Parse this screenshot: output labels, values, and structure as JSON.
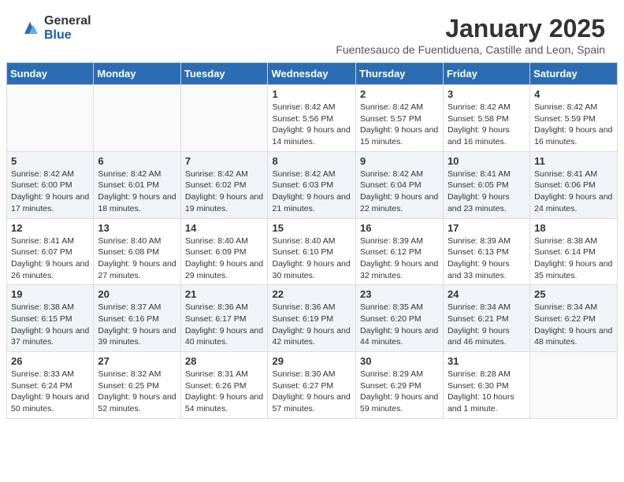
{
  "logo": {
    "general": "General",
    "blue": "Blue"
  },
  "header": {
    "month": "January 2025",
    "location": "Fuentesauco de Fuentiduena, Castille and Leon, Spain"
  },
  "weekdays": [
    "Sunday",
    "Monday",
    "Tuesday",
    "Wednesday",
    "Thursday",
    "Friday",
    "Saturday"
  ],
  "weeks": [
    [
      {
        "day": "",
        "info": ""
      },
      {
        "day": "",
        "info": ""
      },
      {
        "day": "",
        "info": ""
      },
      {
        "day": "1",
        "info": "Sunrise: 8:42 AM\nSunset: 5:56 PM\nDaylight: 9 hours and 14 minutes."
      },
      {
        "day": "2",
        "info": "Sunrise: 8:42 AM\nSunset: 5:57 PM\nDaylight: 9 hours and 15 minutes."
      },
      {
        "day": "3",
        "info": "Sunrise: 8:42 AM\nSunset: 5:58 PM\nDaylight: 9 hours and 16 minutes."
      },
      {
        "day": "4",
        "info": "Sunrise: 8:42 AM\nSunset: 5:59 PM\nDaylight: 9 hours and 16 minutes."
      }
    ],
    [
      {
        "day": "5",
        "info": "Sunrise: 8:42 AM\nSunset: 6:00 PM\nDaylight: 9 hours and 17 minutes."
      },
      {
        "day": "6",
        "info": "Sunrise: 8:42 AM\nSunset: 6:01 PM\nDaylight: 9 hours and 18 minutes."
      },
      {
        "day": "7",
        "info": "Sunrise: 8:42 AM\nSunset: 6:02 PM\nDaylight: 9 hours and 19 minutes."
      },
      {
        "day": "8",
        "info": "Sunrise: 8:42 AM\nSunset: 6:03 PM\nDaylight: 9 hours and 21 minutes."
      },
      {
        "day": "9",
        "info": "Sunrise: 8:42 AM\nSunset: 6:04 PM\nDaylight: 9 hours and 22 minutes."
      },
      {
        "day": "10",
        "info": "Sunrise: 8:41 AM\nSunset: 6:05 PM\nDaylight: 9 hours and 23 minutes."
      },
      {
        "day": "11",
        "info": "Sunrise: 8:41 AM\nSunset: 6:06 PM\nDaylight: 9 hours and 24 minutes."
      }
    ],
    [
      {
        "day": "12",
        "info": "Sunrise: 8:41 AM\nSunset: 6:07 PM\nDaylight: 9 hours and 26 minutes."
      },
      {
        "day": "13",
        "info": "Sunrise: 8:40 AM\nSunset: 6:08 PM\nDaylight: 9 hours and 27 minutes."
      },
      {
        "day": "14",
        "info": "Sunrise: 8:40 AM\nSunset: 6:09 PM\nDaylight: 9 hours and 29 minutes."
      },
      {
        "day": "15",
        "info": "Sunrise: 8:40 AM\nSunset: 6:10 PM\nDaylight: 9 hours and 30 minutes."
      },
      {
        "day": "16",
        "info": "Sunrise: 8:39 AM\nSunset: 6:12 PM\nDaylight: 9 hours and 32 minutes."
      },
      {
        "day": "17",
        "info": "Sunrise: 8:39 AM\nSunset: 6:13 PM\nDaylight: 9 hours and 33 minutes."
      },
      {
        "day": "18",
        "info": "Sunrise: 8:38 AM\nSunset: 6:14 PM\nDaylight: 9 hours and 35 minutes."
      }
    ],
    [
      {
        "day": "19",
        "info": "Sunrise: 8:38 AM\nSunset: 6:15 PM\nDaylight: 9 hours and 37 minutes."
      },
      {
        "day": "20",
        "info": "Sunrise: 8:37 AM\nSunset: 6:16 PM\nDaylight: 9 hours and 39 minutes."
      },
      {
        "day": "21",
        "info": "Sunrise: 8:36 AM\nSunset: 6:17 PM\nDaylight: 9 hours and 40 minutes."
      },
      {
        "day": "22",
        "info": "Sunrise: 8:36 AM\nSunset: 6:19 PM\nDaylight: 9 hours and 42 minutes."
      },
      {
        "day": "23",
        "info": "Sunrise: 8:35 AM\nSunset: 6:20 PM\nDaylight: 9 hours and 44 minutes."
      },
      {
        "day": "24",
        "info": "Sunrise: 8:34 AM\nSunset: 6:21 PM\nDaylight: 9 hours and 46 minutes."
      },
      {
        "day": "25",
        "info": "Sunrise: 8:34 AM\nSunset: 6:22 PM\nDaylight: 9 hours and 48 minutes."
      }
    ],
    [
      {
        "day": "26",
        "info": "Sunrise: 8:33 AM\nSunset: 6:24 PM\nDaylight: 9 hours and 50 minutes."
      },
      {
        "day": "27",
        "info": "Sunrise: 8:32 AM\nSunset: 6:25 PM\nDaylight: 9 hours and 52 minutes."
      },
      {
        "day": "28",
        "info": "Sunrise: 8:31 AM\nSunset: 6:26 PM\nDaylight: 9 hours and 54 minutes."
      },
      {
        "day": "29",
        "info": "Sunrise: 8:30 AM\nSunset: 6:27 PM\nDaylight: 9 hours and 57 minutes."
      },
      {
        "day": "30",
        "info": "Sunrise: 8:29 AM\nSunset: 6:29 PM\nDaylight: 9 hours and 59 minutes."
      },
      {
        "day": "31",
        "info": "Sunrise: 8:28 AM\nSunset: 6:30 PM\nDaylight: 10 hours and 1 minute."
      },
      {
        "day": "",
        "info": ""
      }
    ]
  ]
}
